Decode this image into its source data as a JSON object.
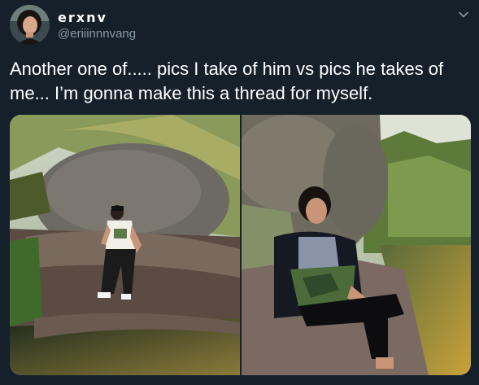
{
  "author": {
    "display_name": "erxnv",
    "handle": "@eriiinnnvang"
  },
  "tweet": {
    "text": "Another one of..... pics I take of him vs pics he takes of\nme... I’m gonna make this a thread for myself."
  },
  "icons": {
    "menu": "chevron-down-icon"
  },
  "colors": {
    "background": "#15202b",
    "text": "#ffffff",
    "secondary_text": "#8899a6"
  }
}
